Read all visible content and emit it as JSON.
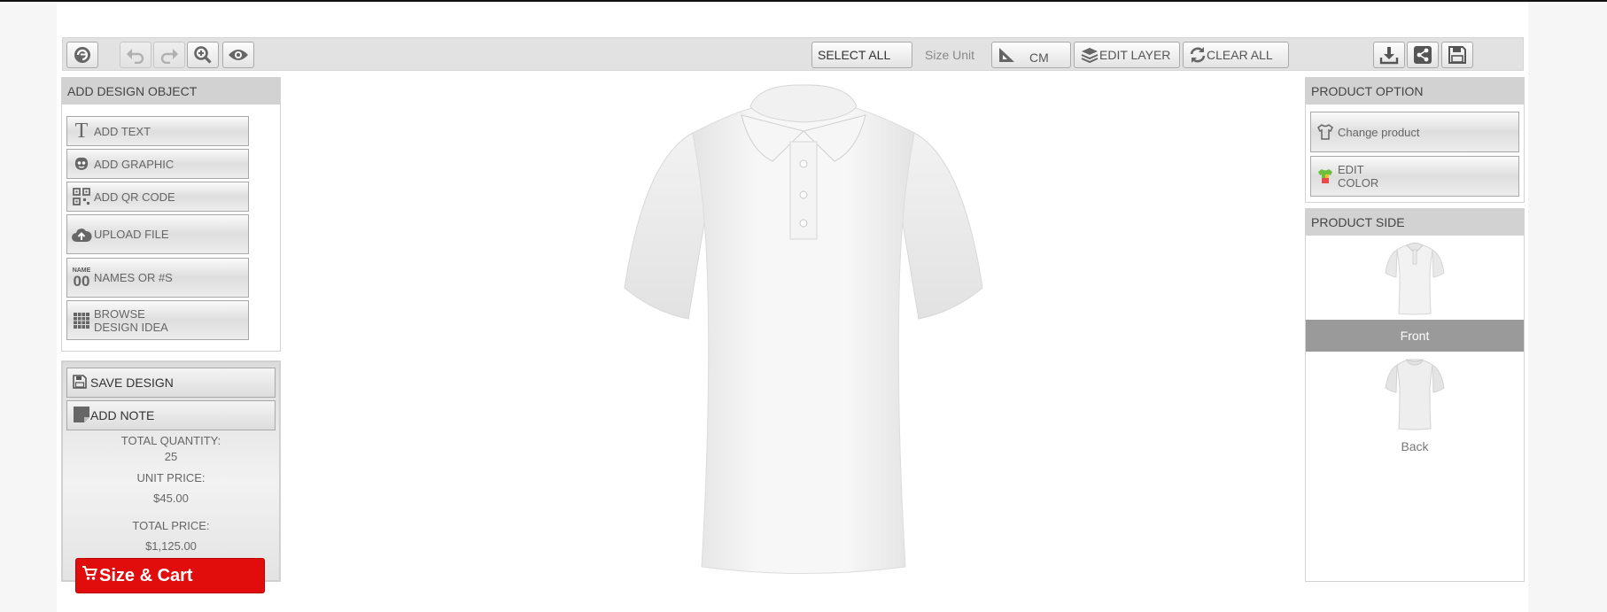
{
  "toolbar": {
    "select_all": "SELECT ALL",
    "size_unit_label": "Size Unit",
    "unit_value": "CM",
    "edit_layer": "EDIT LAYER",
    "clear_all": "CLEAR ALL"
  },
  "design_panel": {
    "title": "ADD DESIGN OBJECT",
    "items": [
      {
        "label": "ADD TEXT",
        "icon": "text-icon"
      },
      {
        "label": "ADD GRAPHIC",
        "icon": "graphic-icon"
      },
      {
        "label": "ADD QR CODE",
        "icon": "qr-code-icon"
      },
      {
        "label": "UPLOAD FILE",
        "icon": "cloud-upload-icon"
      },
      {
        "label": "NAMES OR #S",
        "icon": "names-numbers-icon",
        "icon_text_top": "NAME",
        "icon_text_bottom": "00"
      },
      {
        "label_line1": "BROWSE",
        "label_line2": "DESIGN IDEA",
        "icon": "grid-icon"
      }
    ]
  },
  "summary": {
    "save_design": "SAVE DESIGN",
    "add_note": "ADD NOTE",
    "total_quantity_label": "TOTAL QUANTITY:",
    "total_quantity": "25",
    "unit_price_label": "UNIT PRICE:",
    "unit_price": "$45.00",
    "total_price_label": "TOTAL PRICE:",
    "total_price": "$1,125.00",
    "cart_button": "Size & Cart"
  },
  "product_option": {
    "title": "PRODUCT OPTION",
    "change_product": "Change product",
    "edit_color_line1": "EDIT",
    "edit_color_line2": "COLOR"
  },
  "product_side": {
    "title": "PRODUCT SIDE",
    "sides": [
      {
        "label": "Front",
        "selected": true
      },
      {
        "label": "Back",
        "selected": false
      }
    ]
  },
  "colors": {
    "cart_red": "#e10d0d",
    "selected_side": "#9a9a9a",
    "panel_header": "#d2d2d2"
  }
}
